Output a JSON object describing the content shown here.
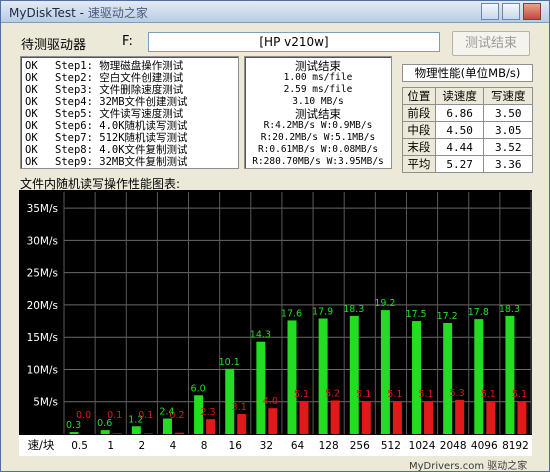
{
  "window": {
    "title_main": "MyDiskTest - ",
    "title_faded": "速驱动之家"
  },
  "toolbar": {
    "drive_label": "待测驱动器",
    "drive_letter": "F:",
    "device_name": "[HP v210w]",
    "end_button": "测试结束"
  },
  "steps": [
    {
      "status": "OK",
      "label": "Step1: 物理磁盘操作测试"
    },
    {
      "status": "OK",
      "label": "Step2: 空白文件创建测试"
    },
    {
      "status": "OK",
      "label": "Step3: 文件删除速度测试"
    },
    {
      "status": "OK",
      "label": "Step4: 32MB文件创建测试"
    },
    {
      "status": "OK",
      "label": "Step5: 文件读写速度测试"
    },
    {
      "status": "OK",
      "label": "Step6: 4.0K随机读写测试"
    },
    {
      "status": "OK",
      "label": "Step7: 512K随机读写测试"
    },
    {
      "status": "OK",
      "label": "Step8: 4.0K文件复制测试"
    },
    {
      "status": "OK",
      "label": "Step9: 32MB文件复制测试"
    }
  ],
  "results": [
    {
      "text": "测试结束",
      "heading": true
    },
    {
      "text": "1.00 ms/file"
    },
    {
      "text": "2.59 ms/file"
    },
    {
      "text": "3.10 MB/s"
    },
    {
      "text": "测试结束",
      "heading": true
    },
    {
      "text": "R:4.2MB/s W:0.9MB/s"
    },
    {
      "text": "R:20.2MB/s W:5.1MB/s"
    },
    {
      "text": "R:0.61MB/s W:0.08MB/s"
    },
    {
      "text": "R:280.70MB/s W:3.95MB/s"
    }
  ],
  "perf": {
    "title": "物理性能(单位MB/s)",
    "headers": [
      "位置",
      "读速度",
      "写速度"
    ],
    "rows": [
      {
        "pos": "前段",
        "read": "6.86",
        "write": "3.50"
      },
      {
        "pos": "中段",
        "read": "4.50",
        "write": "3.05"
      },
      {
        "pos": "末段",
        "read": "4.44",
        "write": "3.52"
      },
      {
        "pos": "平均",
        "read": "5.27",
        "write": "3.36"
      }
    ]
  },
  "chart_caption": "文件内随机读写操作性能图表:",
  "chart_data": {
    "type": "bar",
    "title": "",
    "x_axis_title": "速/块",
    "categories": [
      "0.5",
      "1",
      "2",
      "4",
      "8",
      "16",
      "32",
      "64",
      "128",
      "256",
      "512",
      "1024",
      "2048",
      "4096",
      "8192"
    ],
    "y_ticks": [
      "5M/s",
      "10M/s",
      "15M/s",
      "20M/s",
      "25M/s",
      "30M/s",
      "35M/s"
    ],
    "ylim": [
      0,
      37.5
    ],
    "grid": true,
    "series": [
      {
        "name": "",
        "color": "#22dd22",
        "values": [
          0.3,
          0.6,
          1.2,
          2.4,
          6.0,
          10.1,
          14.3,
          17.6,
          17.9,
          18.3,
          19.2,
          17.5,
          17.2,
          17.8,
          18.3
        ],
        "labels": [
          "0.3",
          "0.6",
          "1.2",
          "2.4",
          "6.0",
          "10.1",
          "14.3",
          "17.6",
          "17.9",
          "18.3",
          "19.2",
          "17.5",
          "17.2",
          "17.8",
          "18.3"
        ]
      },
      {
        "name": "",
        "color": "#e01a1a",
        "values": [
          0.0,
          0.1,
          0.1,
          0.2,
          2.3,
          3.1,
          4.0,
          5.1,
          5.2,
          5.1,
          5.1,
          5.1,
          5.3,
          5.1,
          5.1
        ],
        "labels": [
          "0.0",
          "0.1",
          "0.1",
          "0.2",
          "2.3",
          "3.1",
          "4.0",
          "5.1",
          "5.2",
          "5.1",
          "5.1",
          "5.1",
          "5.3",
          "5.1",
          "5.1"
        ]
      }
    ]
  },
  "watermark": "MyDrivers.com  驱动之家"
}
